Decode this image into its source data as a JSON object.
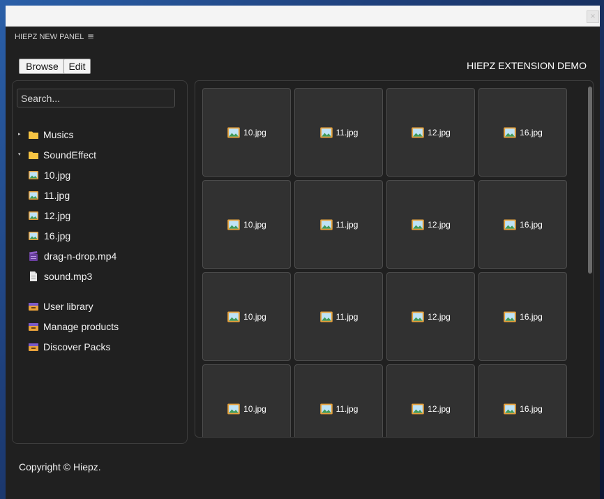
{
  "window": {
    "close_icon": "close-icon",
    "close_glyph": "×"
  },
  "header": {
    "panel_title": "HIEPZ NEW PANEL",
    "menu_icon": "≡"
  },
  "toolbar": {
    "browse_label": "Browse",
    "edit_label": "Edit"
  },
  "demo_title": "HIEPZ EXTENSION DEMO",
  "search": {
    "placeholder": "Search..."
  },
  "tree": [
    {
      "label": "Musics",
      "icon": "folder-icon",
      "caret": "▸"
    },
    {
      "label": "SoundEffect",
      "icon": "folder-icon",
      "caret": "▾"
    },
    {
      "label": "10.jpg",
      "icon": "image-file-icon"
    },
    {
      "label": "11.jpg",
      "icon": "image-file-icon"
    },
    {
      "label": "12.jpg",
      "icon": "image-file-icon"
    },
    {
      "label": "16.jpg",
      "icon": "image-file-icon"
    },
    {
      "label": "drag-n-drop.mp4",
      "icon": "video-file-icon"
    },
    {
      "label": "sound.mp3",
      "icon": "document-icon"
    }
  ],
  "library_links": [
    {
      "label": "User library",
      "icon": "box-icon"
    },
    {
      "label": "Manage products",
      "icon": "box-icon"
    },
    {
      "label": "Discover Packs",
      "icon": "box-icon"
    }
  ],
  "grid_files": [
    "10.jpg",
    "11.jpg",
    "12.jpg",
    "16.jpg",
    "10.jpg",
    "11.jpg",
    "12.jpg",
    "16.jpg",
    "10.jpg",
    "11.jpg",
    "12.jpg",
    "16.jpg",
    "10.jpg",
    "11.jpg",
    "12.jpg",
    "16.jpg"
  ],
  "footer": {
    "copyright": "Copyright © Hiepz."
  },
  "colors": {
    "window_bg": "#202020",
    "folder": "#f6c443",
    "image_icon_frame": "#e8a23c",
    "video_icon": "#6a3f9f"
  }
}
